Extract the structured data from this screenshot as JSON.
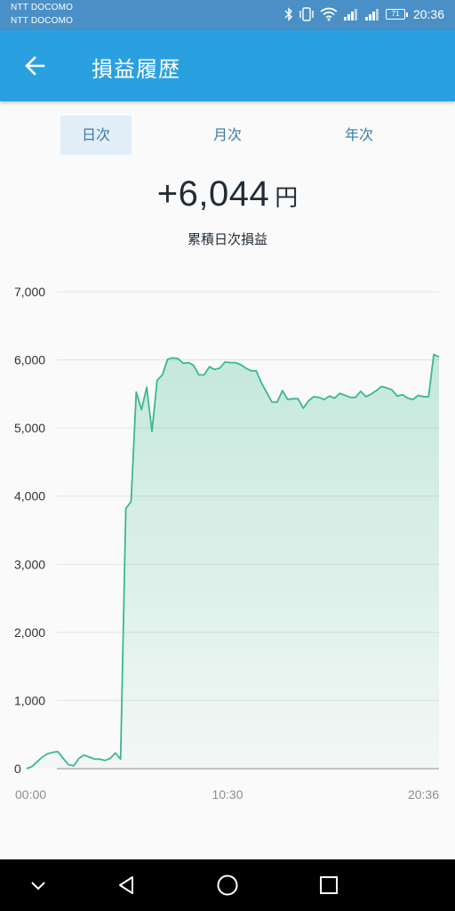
{
  "status_bar": {
    "carrier_1": "NTT DOCOMO",
    "carrier_2": "NTT DOCOMO",
    "battery_level": "71",
    "time": "20:36",
    "icons": [
      "bluetooth-icon",
      "vibrate-icon",
      "wifi-icon",
      "signal-icon",
      "signal-icon",
      "battery-icon"
    ]
  },
  "app_bar": {
    "title": "損益履歴",
    "back_icon": "arrow-left-icon"
  },
  "tabs": [
    {
      "label": "日次",
      "active": true
    },
    {
      "label": "月次",
      "active": false
    },
    {
      "label": "年次",
      "active": false
    }
  ],
  "summary": {
    "amount": "+6,044",
    "unit": "円",
    "label": "累積日次損益"
  },
  "chart_data": {
    "type": "area",
    "ylim": [
      0,
      7000
    ],
    "y_ticks": [
      0,
      1000,
      2000,
      3000,
      4000,
      5000,
      6000,
      7000
    ],
    "y_tick_labels": [
      "0",
      "1,000",
      "2,000",
      "3,000",
      "4,000",
      "5,000",
      "6,000",
      "7,000"
    ],
    "x_tick_labels": [
      "00:00",
      "10:30",
      "20:36"
    ],
    "grid": true,
    "color": "#3cb890",
    "values": [
      0,
      30,
      100,
      170,
      220,
      240,
      250,
      150,
      60,
      40,
      150,
      200,
      170,
      140,
      140,
      120,
      150,
      230,
      140,
      3820,
      3920,
      5530,
      5270,
      5600,
      4950,
      5700,
      5780,
      6010,
      6030,
      6020,
      5950,
      5960,
      5920,
      5780,
      5780,
      5900,
      5860,
      5880,
      5970,
      5960,
      5960,
      5930,
      5880,
      5840,
      5840,
      5660,
      5520,
      5380,
      5380,
      5550,
      5420,
      5430,
      5430,
      5290,
      5400,
      5460,
      5450,
      5420,
      5470,
      5440,
      5510,
      5480,
      5450,
      5450,
      5540,
      5460,
      5500,
      5550,
      5610,
      5590,
      5560,
      5470,
      5490,
      5440,
      5420,
      5480,
      5460,
      5460,
      6080,
      6044
    ]
  },
  "nav_bar": {
    "icons": [
      "chevron-down-icon",
      "back-triangle-icon",
      "home-circle-icon",
      "recents-square-icon"
    ]
  }
}
